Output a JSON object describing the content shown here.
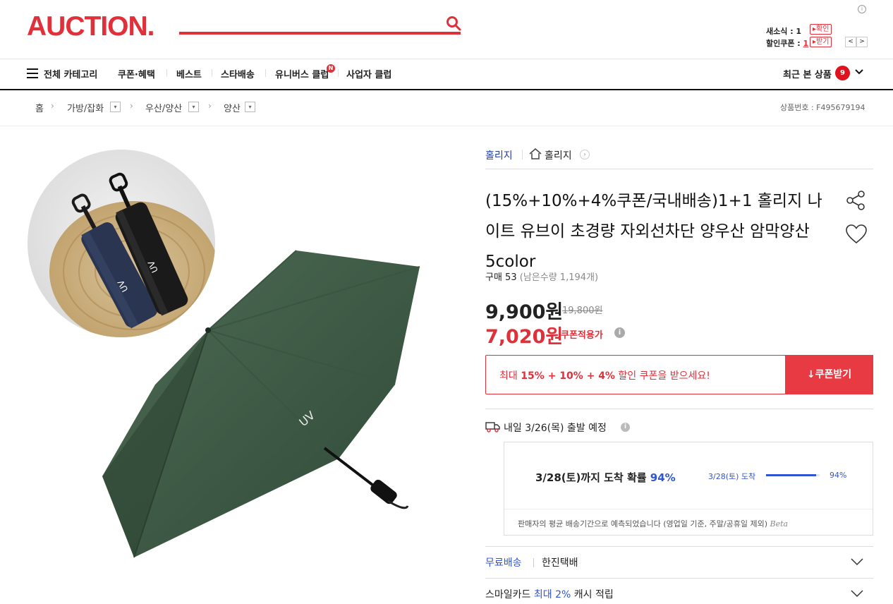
{
  "header": {
    "logo": "AUCTION.",
    "info": "i",
    "news_label": "새소식 : 1",
    "news_button": "확인",
    "coupon_label_prefix": "할인쿠폰 : ",
    "coupon_count": "1",
    "coupon_button": "받기",
    "arrow_prev": "<",
    "arrow_next": ">"
  },
  "nav": {
    "all_categories": "전체 카테고리",
    "items": [
      "쿠폰·혜택",
      "베스트",
      "스타배송",
      "유니버스 클럽",
      "사업자 클럽"
    ],
    "new_badge": "N",
    "recent_label": "최근 본 상품",
    "recent_count": "9"
  },
  "breadcrumb": {
    "home": "홈",
    "levels": [
      "가방/잡화",
      "우산/양산",
      "양산"
    ],
    "product_no": "상품번호 : F495679194"
  },
  "seller": {
    "store": "홀리지",
    "name": "홀리지"
  },
  "product": {
    "title": "(15%+10%+4%쿠폰/국내배송)1+1 홀리지 나이트 유브이 초경량 자외선차단 양우산 암막양산 5color",
    "purchases": "구매 53",
    "stock": "(남은수량 1,194개)",
    "price": "9,900원",
    "original_price": "19,800원",
    "coupon_price": "7,020원",
    "coupon_applied": "쿠폰적용가"
  },
  "coupon": {
    "msg_prefix": "최대 ",
    "msg_bold": "15% + 10% + 4%",
    "msg_suffix": " 할인 쿠폰을 받으세요!",
    "button": "쿠폰받기"
  },
  "shipping": {
    "departure": "내일 3/26(목) 출발 예정",
    "eta_text": "3/28(토)까지 도착 확률 ",
    "eta_pct": "94%",
    "eta_small": "3/28(토) 도착",
    "eta_bar_pct": "94%",
    "eta_fraction": 0.94,
    "note": "판매자의 평균 배송기간으로 예측되었습니다 (영업일 기준, 주말/공휴일 제외) ",
    "beta": "Beta",
    "free": "무료배송",
    "courier": "한진택배",
    "card_prefix": "스마일카드 ",
    "card_highlight": "최대 2%",
    "card_suffix": " 캐시 적립"
  },
  "colors": {
    "brand": "#e0313b",
    "link_blue": "#2f55d4",
    "umbrella_green": "#3d5a46",
    "umbrella_navy": "#2a3552"
  }
}
